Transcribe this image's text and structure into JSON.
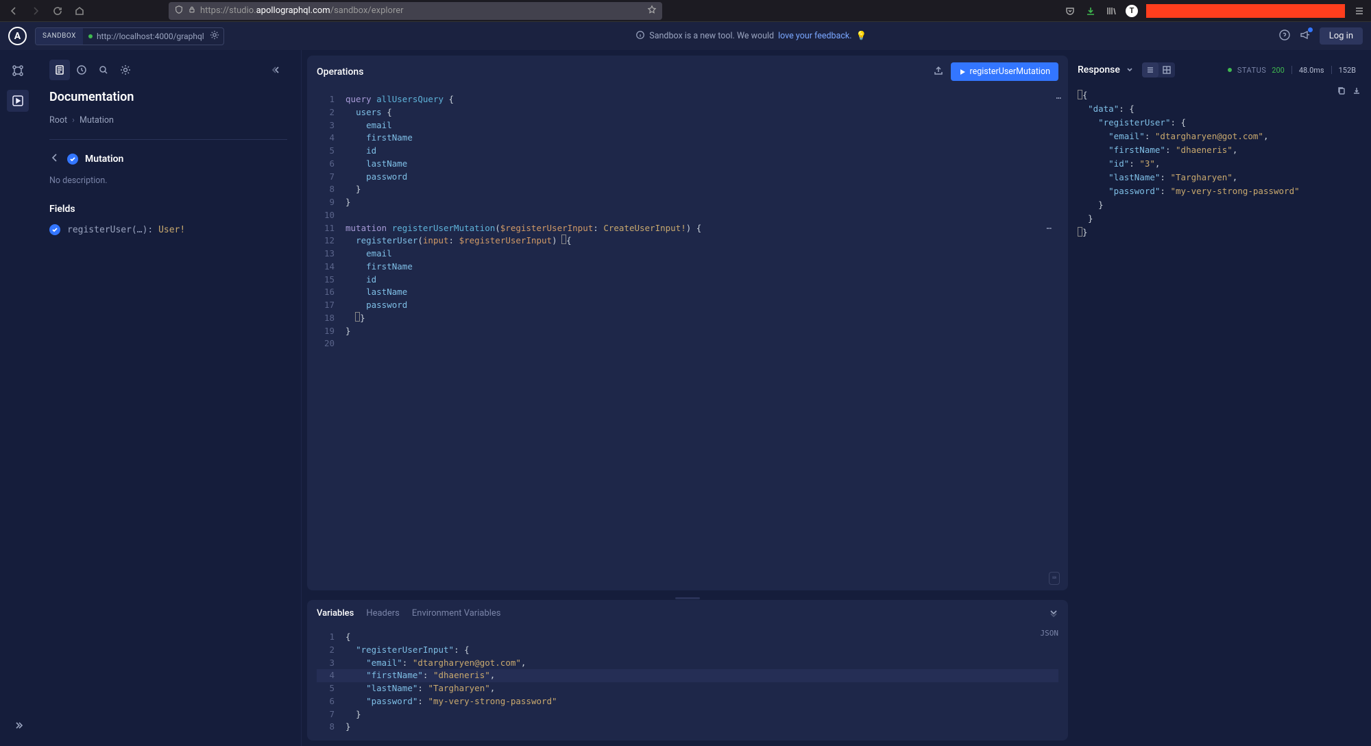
{
  "browser": {
    "url_prefix": "https://studio.",
    "url_bold": "apollographql.com",
    "url_suffix": "/sandbox/explorer"
  },
  "header": {
    "sandbox_label": "SANDBOX",
    "sandbox_url": "http://localhost:4000/graphql",
    "msg_before": "Sandbox is a new tool. We would ",
    "msg_link": "love your feedback.",
    "login_label": "Log in"
  },
  "sidebar": {
    "doc_title": "Documentation",
    "crumb_root": "Root",
    "crumb_leaf": "Mutation",
    "mutation_label": "Mutation",
    "description": "No description.",
    "fields_label": "Fields",
    "field_name": "registerUser(…)",
    "field_type": "User!"
  },
  "ops": {
    "title": "Operations",
    "run_label": "registerUserMutation",
    "lines": [
      {
        "n": "1",
        "seg": [
          {
            "c": "kw",
            "t": "query "
          },
          {
            "c": "fn",
            "t": "allUsersQuery"
          },
          {
            "c": "p",
            "t": " {"
          }
        ]
      },
      {
        "n": "2",
        "seg": [
          {
            "c": "p",
            "t": "  "
          },
          {
            "c": "fld",
            "t": "users"
          },
          {
            "c": "p",
            "t": " {"
          }
        ]
      },
      {
        "n": "3",
        "seg": [
          {
            "c": "p",
            "t": "    "
          },
          {
            "c": "fld",
            "t": "email"
          }
        ]
      },
      {
        "n": "4",
        "seg": [
          {
            "c": "p",
            "t": "    "
          },
          {
            "c": "fld",
            "t": "firstName"
          }
        ]
      },
      {
        "n": "5",
        "seg": [
          {
            "c": "p",
            "t": "    "
          },
          {
            "c": "fld",
            "t": "id"
          }
        ]
      },
      {
        "n": "6",
        "seg": [
          {
            "c": "p",
            "t": "    "
          },
          {
            "c": "fld",
            "t": "lastName"
          }
        ]
      },
      {
        "n": "7",
        "seg": [
          {
            "c": "p",
            "t": "    "
          },
          {
            "c": "fld",
            "t": "password"
          }
        ]
      },
      {
        "n": "8",
        "seg": [
          {
            "c": "p",
            "t": "  }"
          }
        ]
      },
      {
        "n": "9",
        "seg": [
          {
            "c": "p",
            "t": "}"
          }
        ]
      },
      {
        "n": "10",
        "seg": []
      },
      {
        "n": "11",
        "dots": true,
        "seg": [
          {
            "c": "kw",
            "t": "mutation "
          },
          {
            "c": "fn",
            "t": "registerUserMutation"
          },
          {
            "c": "p",
            "t": "("
          },
          {
            "c": "vr",
            "t": "$registerUserInput"
          },
          {
            "c": "p",
            "t": ": "
          },
          {
            "c": "ty",
            "t": "CreateUserInput!"
          },
          {
            "c": "p",
            "t": ") {"
          }
        ]
      },
      {
        "n": "12",
        "seg": [
          {
            "c": "p",
            "t": "  "
          },
          {
            "c": "fld",
            "t": "registerUser"
          },
          {
            "c": "p",
            "t": "("
          },
          {
            "c": "pn",
            "t": "input"
          },
          {
            "c": "p",
            "t": ": "
          },
          {
            "c": "vr",
            "t": "$registerUserInput"
          },
          {
            "c": "p",
            "t": ") "
          },
          {
            "c": "cursor",
            "t": ""
          },
          {
            "c": "p",
            "t": "{"
          }
        ]
      },
      {
        "n": "13",
        "seg": [
          {
            "c": "p",
            "t": "    "
          },
          {
            "c": "fld",
            "t": "email"
          }
        ]
      },
      {
        "n": "14",
        "seg": [
          {
            "c": "p",
            "t": "    "
          },
          {
            "c": "fld",
            "t": "firstName"
          }
        ]
      },
      {
        "n": "15",
        "seg": [
          {
            "c": "p",
            "t": "    "
          },
          {
            "c": "fld",
            "t": "id"
          }
        ]
      },
      {
        "n": "16",
        "seg": [
          {
            "c": "p",
            "t": "    "
          },
          {
            "c": "fld",
            "t": "lastName"
          }
        ]
      },
      {
        "n": "17",
        "seg": [
          {
            "c": "p",
            "t": "    "
          },
          {
            "c": "fld",
            "t": "password"
          }
        ]
      },
      {
        "n": "18",
        "seg": [
          {
            "c": "p",
            "t": "  "
          },
          {
            "c": "cursor",
            "t": ""
          },
          {
            "c": "p",
            "t": "}"
          }
        ]
      },
      {
        "n": "19",
        "seg": [
          {
            "c": "p",
            "t": "}"
          }
        ]
      },
      {
        "n": "20",
        "seg": []
      }
    ]
  },
  "vars": {
    "tab_variables": "Variables",
    "tab_headers": "Headers",
    "tab_env": "Environment Variables",
    "json_badge": "JSON",
    "lines": [
      {
        "n": "1",
        "seg": [
          {
            "c": "p",
            "t": "{"
          }
        ]
      },
      {
        "n": "2",
        "seg": [
          {
            "c": "p",
            "t": "  "
          },
          {
            "c": "jk",
            "t": "\"registerUserInput\""
          },
          {
            "c": "p",
            "t": ": "
          },
          {
            "c": "cursor",
            "t": ""
          },
          {
            "c": "p",
            "t": "{"
          }
        ]
      },
      {
        "n": "3",
        "seg": [
          {
            "c": "p",
            "t": "    "
          },
          {
            "c": "jk",
            "t": "\"email\""
          },
          {
            "c": "p",
            "t": ": "
          },
          {
            "c": "js",
            "t": "\"dtargharyen@got.com\""
          },
          {
            "c": "p",
            "t": ","
          }
        ]
      },
      {
        "n": "4",
        "hl": true,
        "seg": [
          {
            "c": "p",
            "t": "    "
          },
          {
            "c": "jk",
            "t": "\"firstName\""
          },
          {
            "c": "p",
            "t": ": "
          },
          {
            "c": "js",
            "t": "\"dhaeneris\""
          },
          {
            "c": "p",
            "t": ","
          }
        ]
      },
      {
        "n": "5",
        "seg": [
          {
            "c": "p",
            "t": "    "
          },
          {
            "c": "jk",
            "t": "\"lastName\""
          },
          {
            "c": "p",
            "t": ": "
          },
          {
            "c": "js",
            "t": "\"Targharyen\""
          },
          {
            "c": "p",
            "t": ","
          }
        ]
      },
      {
        "n": "6",
        "seg": [
          {
            "c": "p",
            "t": "    "
          },
          {
            "c": "jk",
            "t": "\"password\""
          },
          {
            "c": "p",
            "t": ": "
          },
          {
            "c": "js",
            "t": "\"my-very-strong-password\""
          }
        ]
      },
      {
        "n": "7",
        "seg": [
          {
            "c": "p",
            "t": "  "
          },
          {
            "c": "cursor",
            "t": ""
          },
          {
            "c": "p",
            "t": "}"
          }
        ]
      },
      {
        "n": "8",
        "seg": [
          {
            "c": "p",
            "t": "}"
          }
        ]
      }
    ]
  },
  "resp": {
    "title": "Response",
    "status_label": "STATUS",
    "status_code": "200",
    "time": "48.0ms",
    "size": "152B",
    "lines": [
      {
        "seg": [
          {
            "c": "cursor",
            "t": ""
          },
          {
            "c": "p",
            "t": "{"
          }
        ]
      },
      {
        "seg": [
          {
            "c": "p",
            "t": "  "
          },
          {
            "c": "rk",
            "t": "\"data\""
          },
          {
            "c": "p",
            "t": ": {"
          }
        ]
      },
      {
        "seg": [
          {
            "c": "p",
            "t": "    "
          },
          {
            "c": "rk",
            "t": "\"registerUser\""
          },
          {
            "c": "p",
            "t": ": {"
          }
        ]
      },
      {
        "seg": [
          {
            "c": "p",
            "t": "      "
          },
          {
            "c": "rk",
            "t": "\"email\""
          },
          {
            "c": "p",
            "t": ": "
          },
          {
            "c": "rs",
            "t": "\"dtargharyen@got.com\""
          },
          {
            "c": "p",
            "t": ","
          }
        ]
      },
      {
        "seg": [
          {
            "c": "p",
            "t": "      "
          },
          {
            "c": "rk",
            "t": "\"firstName\""
          },
          {
            "c": "p",
            "t": ": "
          },
          {
            "c": "rs",
            "t": "\"dhaeneris\""
          },
          {
            "c": "p",
            "t": ","
          }
        ]
      },
      {
        "seg": [
          {
            "c": "p",
            "t": "      "
          },
          {
            "c": "rk",
            "t": "\"id\""
          },
          {
            "c": "p",
            "t": ": "
          },
          {
            "c": "rs",
            "t": "\"3\""
          },
          {
            "c": "p",
            "t": ","
          }
        ]
      },
      {
        "seg": [
          {
            "c": "p",
            "t": "      "
          },
          {
            "c": "rk",
            "t": "\"lastName\""
          },
          {
            "c": "p",
            "t": ": "
          },
          {
            "c": "rs",
            "t": "\"Targharyen\""
          },
          {
            "c": "p",
            "t": ","
          }
        ]
      },
      {
        "seg": [
          {
            "c": "p",
            "t": "      "
          },
          {
            "c": "rk",
            "t": "\"password\""
          },
          {
            "c": "p",
            "t": ": "
          },
          {
            "c": "rs",
            "t": "\"my-very-strong-password\""
          }
        ]
      },
      {
        "seg": [
          {
            "c": "p",
            "t": "    }"
          }
        ]
      },
      {
        "seg": [
          {
            "c": "p",
            "t": "  }"
          }
        ]
      },
      {
        "seg": [
          {
            "c": "cursor",
            "t": ""
          },
          {
            "c": "p",
            "t": "}"
          }
        ]
      }
    ]
  }
}
